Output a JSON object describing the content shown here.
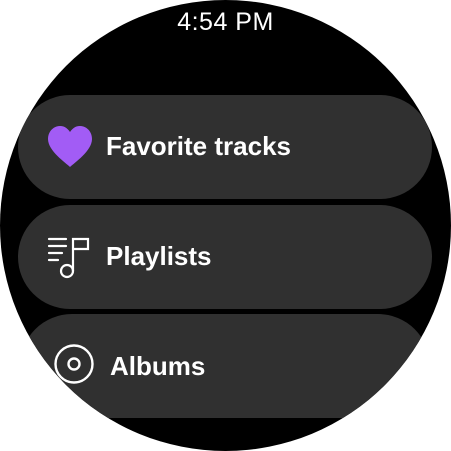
{
  "status": {
    "time": "4:54 PM"
  },
  "menu": {
    "items": [
      {
        "label": "Favorite tracks",
        "icon": "heart-icon",
        "icon_color": "#a25cf5"
      },
      {
        "label": "Playlists",
        "icon": "playlist-icon",
        "icon_color": "#ffffff"
      },
      {
        "label": "Albums",
        "icon": "album-icon",
        "icon_color": "#ffffff"
      }
    ]
  },
  "colors": {
    "background": "#000000",
    "chip": "#303030",
    "accent": "#a25cf5",
    "text": "#ffffff"
  }
}
